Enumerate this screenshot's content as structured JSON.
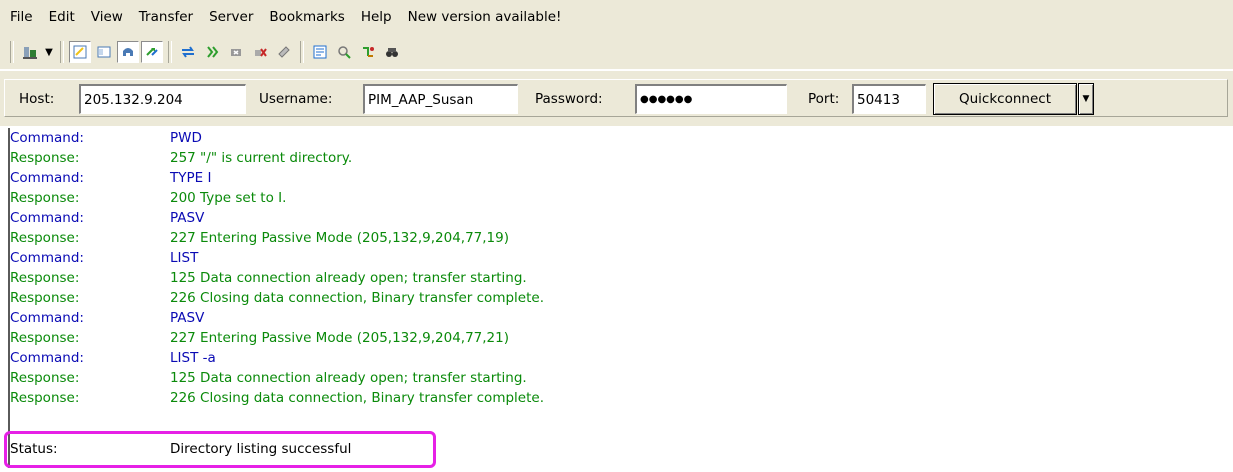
{
  "menu": [
    "File",
    "Edit",
    "View",
    "Transfer",
    "Server",
    "Bookmarks",
    "Help",
    "New version available!"
  ],
  "toolbar": {
    "icons": [
      {
        "name": "site-manager-icon",
        "color": "#2e7d32"
      },
      {
        "name": "message-log-toggle-icon",
        "color": "#f0c419"
      },
      {
        "name": "local-tree-toggle-icon",
        "color": "#4a7ab5"
      },
      {
        "name": "remote-tree-toggle-icon",
        "color": "#4a7ab5"
      },
      {
        "name": "transfer-queue-toggle-icon",
        "color": "#2e9e2e"
      },
      {
        "name": "refresh-icon",
        "color": "#1f6fcf"
      },
      {
        "name": "process-queue-icon",
        "color": "#2e9e2e"
      },
      {
        "name": "cancel-operation-icon",
        "color": "#666666"
      },
      {
        "name": "disconnect-icon",
        "color": "#c62828"
      },
      {
        "name": "reconnect-icon",
        "color": "#777777"
      },
      {
        "name": "directory-filter-icon",
        "color": "#1f6fcf"
      },
      {
        "name": "sync-browsing-icon",
        "color": "#2e9e2e"
      },
      {
        "name": "compare-directories-icon",
        "color": "#c07a00"
      },
      {
        "name": "search-remote-icon",
        "color": "#333333"
      }
    ]
  },
  "quickconnect": {
    "host_label": "Host:",
    "host_value": "205.132.9.204",
    "username_label": "Username:",
    "username_value": "PIM_AAP_Susan",
    "password_label": "Password:",
    "password_value": "●●●●●●",
    "port_label": "Port:",
    "port_value": "50413",
    "button_label": "Quickconnect"
  },
  "log": [
    {
      "kind": "Command:",
      "type": "command",
      "message": "PWD"
    },
    {
      "kind": "Response:",
      "type": "response",
      "message": "257 \"/\" is current directory."
    },
    {
      "kind": "Command:",
      "type": "command",
      "message": "TYPE I"
    },
    {
      "kind": "Response:",
      "type": "response",
      "message": "200 Type set to I."
    },
    {
      "kind": "Command:",
      "type": "command",
      "message": "PASV"
    },
    {
      "kind": "Response:",
      "type": "response",
      "message": "227 Entering Passive Mode (205,132,9,204,77,19)"
    },
    {
      "kind": "Command:",
      "type": "command",
      "message": "LIST"
    },
    {
      "kind": "Response:",
      "type": "response",
      "message": "125 Data connection already open; transfer starting."
    },
    {
      "kind": "Response:",
      "type": "response",
      "message": "226 Closing data connection, Binary transfer complete."
    },
    {
      "kind": "Command:",
      "type": "command",
      "message": "PASV"
    },
    {
      "kind": "Response:",
      "type": "response",
      "message": "227 Entering Passive Mode (205,132,9,204,77,21)"
    },
    {
      "kind": "Command:",
      "type": "command",
      "message": "LIST -a"
    },
    {
      "kind": "Response:",
      "type": "response",
      "message": "125 Data connection already open; transfer starting."
    },
    {
      "kind": "Response:",
      "type": "response",
      "message": "226 Closing data connection, Binary transfer complete."
    },
    {
      "kind": "Status:",
      "type": "status",
      "message": "Directory listing successful"
    }
  ],
  "colors": {
    "command": "#0a0ab4",
    "response": "#0a8a0a",
    "status": "#000000",
    "highlight": "#e620e6"
  }
}
